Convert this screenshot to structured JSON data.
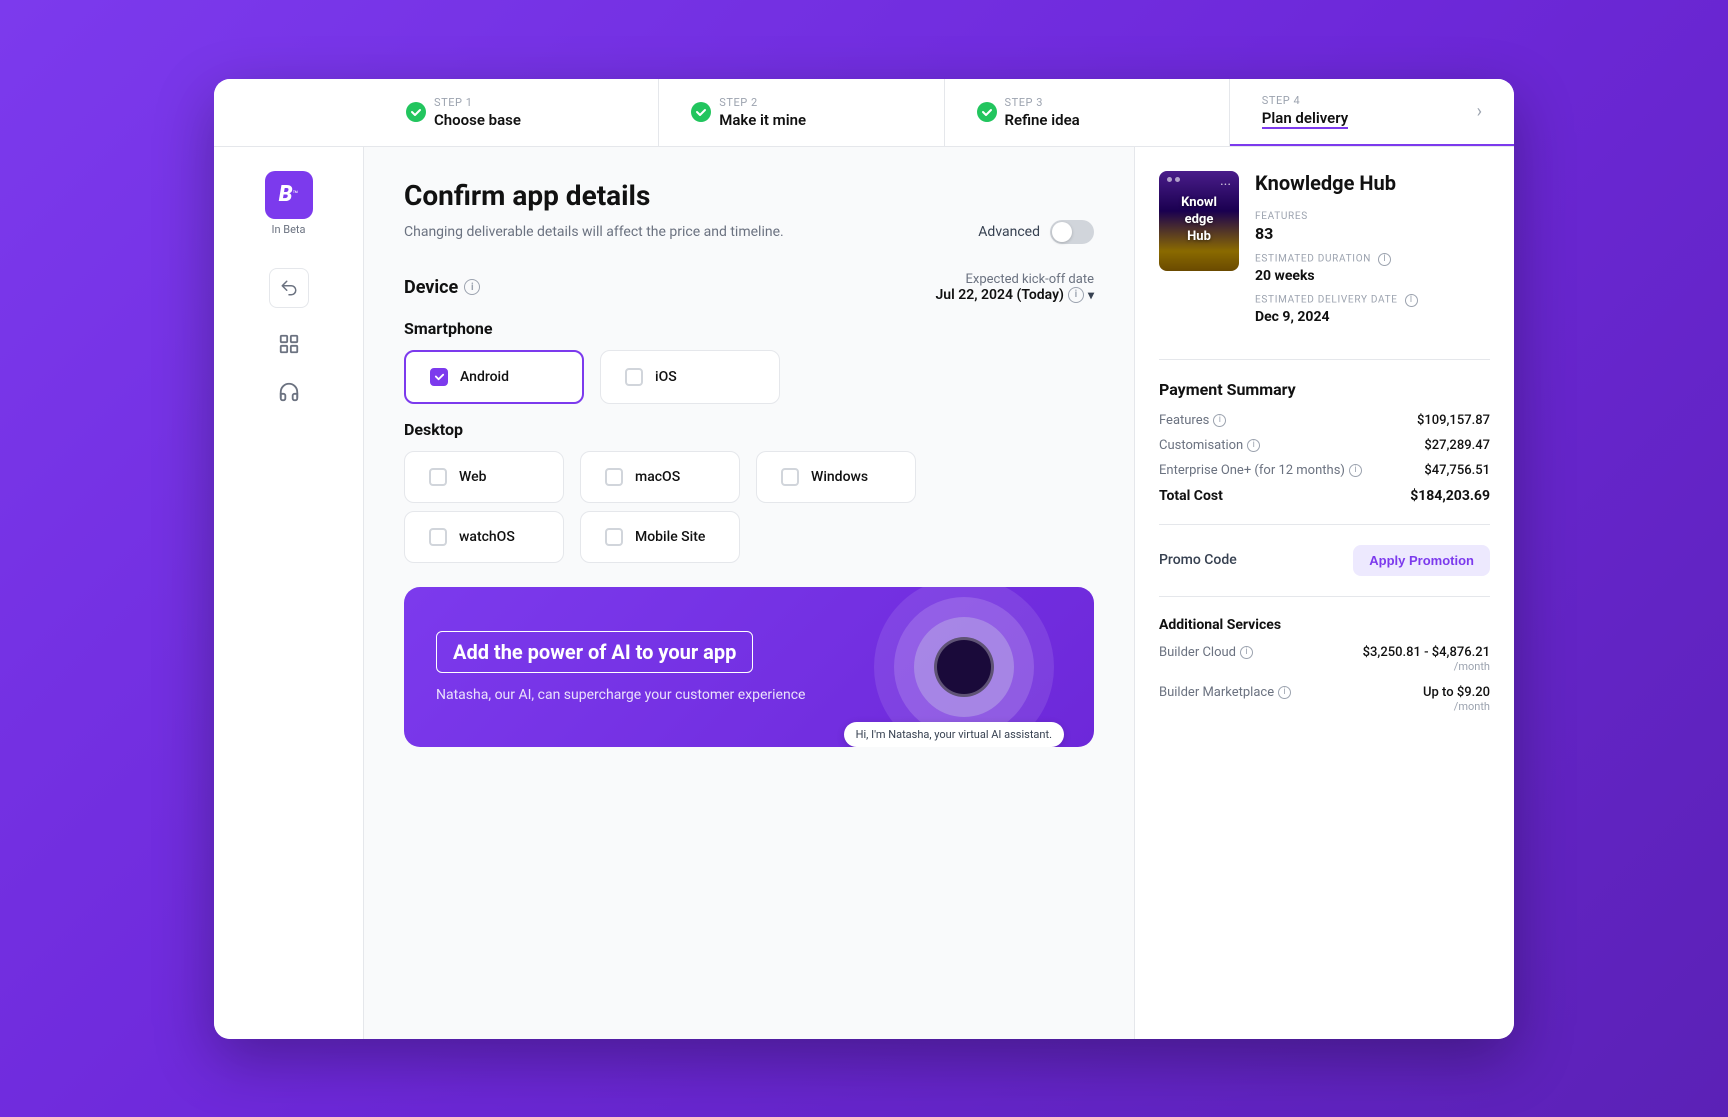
{
  "app": {
    "logo": "B",
    "logo_tm": "™",
    "logo_label": "In Beta"
  },
  "stepper": {
    "steps": [
      {
        "number": "STEP 1",
        "label": "Choose base",
        "completed": true
      },
      {
        "number": "STEP 2",
        "label": "Make it mine",
        "completed": true
      },
      {
        "number": "STEP 3",
        "label": "Refine idea",
        "completed": true
      },
      {
        "number": "STEP 4",
        "label": "Plan delivery",
        "active": true
      }
    ]
  },
  "page": {
    "title": "Confirm app details",
    "subtitle": "Changing deliverable details will affect the price and timeline.",
    "advanced_label": "Advanced"
  },
  "device": {
    "section_title": "Device",
    "kickoff_label": "Expected kick-off date",
    "kickoff_date": "Jul 22, 2024 (Today)",
    "smartphone_title": "Smartphone",
    "options_smartphone": [
      {
        "id": "android",
        "label": "Android",
        "selected": true
      },
      {
        "id": "ios",
        "label": "iOS",
        "selected": false
      }
    ],
    "desktop_title": "Desktop",
    "options_desktop": [
      {
        "id": "web",
        "label": "Web",
        "selected": false
      },
      {
        "id": "macos",
        "label": "macOS",
        "selected": false
      },
      {
        "id": "windows",
        "label": "Windows",
        "selected": false
      },
      {
        "id": "watchos",
        "label": "watchOS",
        "selected": false
      },
      {
        "id": "mobilesite",
        "label": "Mobile Site",
        "selected": false
      }
    ]
  },
  "ai_banner": {
    "title": "Add the power of AI to your app",
    "subtitle": "Natasha, our AI, can supercharge your customer experience",
    "bubble": "Hi, I'm Natasha, your virtual AI assistant."
  },
  "right_panel": {
    "app_name": "Knowledge Hub",
    "features_label": "FEATURES",
    "features_value": "83",
    "duration_label": "ESTIMATED DURATION",
    "duration_value": "20 weeks",
    "delivery_label": "ESTIMATED DELIVERY DATE",
    "delivery_value": "Dec 9, 2024",
    "payment": {
      "title": "Payment Summary",
      "rows": [
        {
          "label": "Features",
          "value": "$109,157.87"
        },
        {
          "label": "Customisation",
          "value": "$27,289.47"
        },
        {
          "label": "Enterprise One+ (for 12 months)",
          "value": "$47,756.51"
        }
      ],
      "total_label": "Total Cost",
      "total_value": "$184,203.69"
    },
    "promo": {
      "label": "Promo Code",
      "button": "Apply Promotion"
    },
    "additional": {
      "title": "Additional Services",
      "services": [
        {
          "label": "Builder Cloud",
          "value": "$3,250.81 - $4,876.21",
          "sub": "/month"
        },
        {
          "label": "Builder Marketplace",
          "value": "Up to $9.20",
          "sub": "/month"
        }
      ]
    }
  }
}
